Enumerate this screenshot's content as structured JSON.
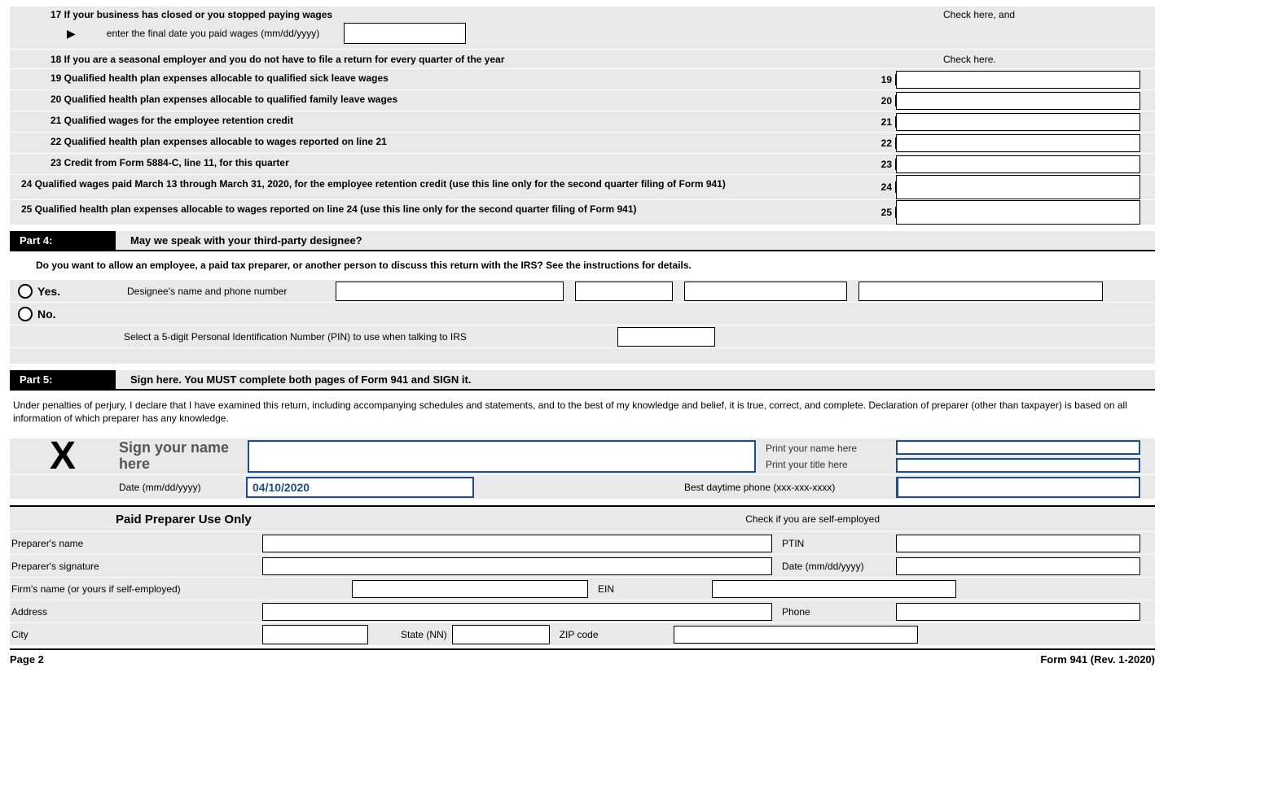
{
  "line17": {
    "text": "17 If your business has closed or you stopped paying wages",
    "subtext": "enter the final date you paid wages (mm/dd/yyyy)",
    "check_label": "Check here, and"
  },
  "line18": {
    "text": "18 If you are a seasonal employer and you do not have to file a return for every quarter of the year",
    "check_label": "Check here."
  },
  "lines": {
    "l19": {
      "num": "19",
      "text": "19 Qualified health plan expenses allocable to qualified sick leave wages"
    },
    "l20": {
      "num": "20",
      "text": "20 Qualified health plan expenses allocable to qualified family leave wages"
    },
    "l21": {
      "num": "21",
      "text": "21 Qualified wages for the employee retention credit"
    },
    "l22": {
      "num": "22",
      "text": "22 Qualified health plan expenses allocable to wages reported on line 21"
    },
    "l23": {
      "num": "23",
      "text": "23 Credit from Form 5884-C, line 11, for this quarter"
    },
    "l24": {
      "num": "24",
      "text": "24 Qualified wages paid March 13 through March 31, 2020, for the employee retention credit (use this line only for the second quarter filing of Form 941)"
    },
    "l25": {
      "num": "25",
      "text": "25 Qualified health plan expenses allocable to wages reported on line 24 (use this line only for the second quarter filing of Form 941)"
    }
  },
  "part4": {
    "label": "Part 4:",
    "title": "May we speak with your third-party designee?",
    "question": "Do you want to allow an employee, a paid tax preparer, or another person to discuss this return with the IRS?  See the instructions for details.",
    "yes": "Yes.",
    "no": "No.",
    "designee_label": "Designee's name and phone number",
    "pin_label": "Select a 5-digit Personal Identification Number (PIN) to use when talking to IRS"
  },
  "part5": {
    "label": "Part 5:",
    "title": "Sign here.  You MUST complete both pages of Form 941 and SIGN it.",
    "declaration": "Under penalties of perjury, I declare that I have examined this return, including accompanying schedules and statements, and to the best of my knowledge and belief, it is true, correct, and complete. Declaration of preparer (other than taxpayer) is based on all information of which preparer has any knowledge.",
    "x": "X",
    "sign_label": "Sign your name here",
    "print_name": "Print your name here",
    "print_title": "Print your title here",
    "date_label": "Date (mm/dd/yyyy)",
    "date_value": "04/10/2020",
    "phone_label": "Best daytime phone (xxx-xxx-xxxx)"
  },
  "preparer": {
    "header": "Paid Preparer Use Only",
    "self_emp": "Check if you are self-employed",
    "name": "Preparer's name",
    "ptin": "PTIN",
    "signature": "Preparer's signature",
    "date": "Date (mm/dd/yyyy)",
    "firm": "Firm's name (or yours if self-employed)",
    "ein": "EIN",
    "address": "Address",
    "phone": "Phone",
    "city": "City",
    "state": "State (NN)",
    "zip": "ZIP code"
  },
  "footer": {
    "page": "Page 2",
    "form": "Form 941 (Rev. 1-2020)"
  }
}
